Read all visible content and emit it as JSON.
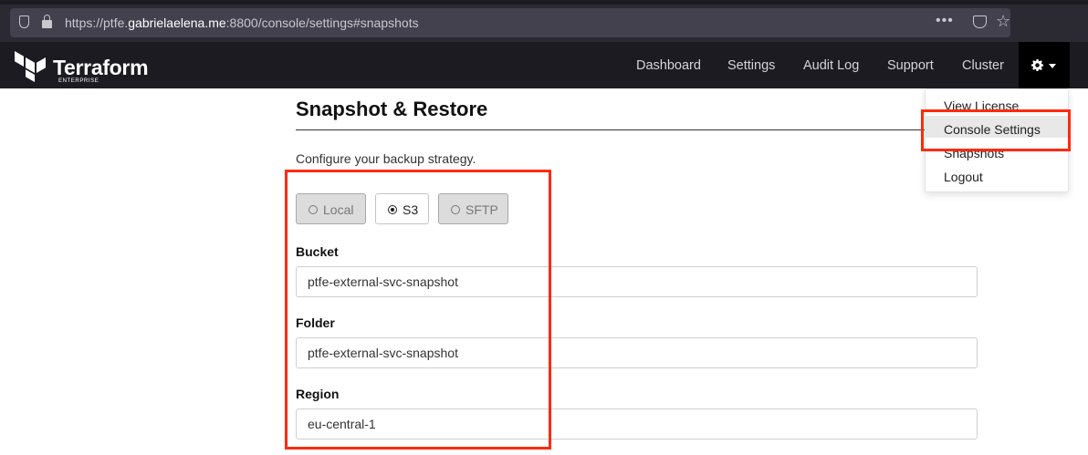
{
  "browser": {
    "url_prefix": "https://ptfe.",
    "url_domain": "gabrielaelena.me",
    "url_suffix": ":8800/console/settings#snapshots",
    "page_actions_icon": "more-dots-icon",
    "pocket_icon": "pocket-icon",
    "bookmark_icon": "star-icon"
  },
  "brand": {
    "name": "Terraform",
    "edition": "ENTERPRISE"
  },
  "nav": {
    "items": [
      {
        "label": "Dashboard"
      },
      {
        "label": "Settings"
      },
      {
        "label": "Audit Log"
      },
      {
        "label": "Support"
      },
      {
        "label": "Cluster"
      }
    ],
    "gear_icon": "gear-icon"
  },
  "dropdown": {
    "items": [
      {
        "label": "View License"
      },
      {
        "label": "Console Settings"
      },
      {
        "label": "Snapshots"
      },
      {
        "label": "Logout"
      }
    ]
  },
  "main": {
    "title": "Snapshot & Restore",
    "subtitle": "Configure your backup strategy.",
    "storage_options": [
      {
        "label": "Local",
        "selected": false
      },
      {
        "label": "S3",
        "selected": true
      },
      {
        "label": "SFTP",
        "selected": false
      }
    ],
    "fields": [
      {
        "label": "Bucket",
        "value": "ptfe-external-svc-snapshot"
      },
      {
        "label": "Folder",
        "value": "ptfe-external-svc-snapshot"
      },
      {
        "label": "Region",
        "value": "eu-central-1"
      }
    ]
  },
  "colors": {
    "navbar": "#1c1b22",
    "annotation": "#ff2a0d"
  }
}
